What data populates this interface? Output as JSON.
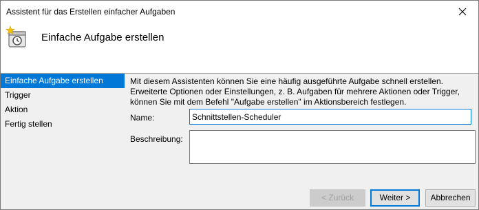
{
  "window": {
    "title": "Assistent für das Erstellen einfacher Aufgaben"
  },
  "header": {
    "title": "Einfache Aufgabe erstellen",
    "icon": "task-scheduler-icon"
  },
  "sidebar": {
    "items": [
      {
        "label": "Einfache Aufgabe erstellen",
        "active": true
      },
      {
        "label": "Trigger"
      },
      {
        "label": "Aktion"
      },
      {
        "label": "Fertig stellen"
      }
    ]
  },
  "main": {
    "intro": [
      "Mit diesem Assistenten können Sie eine häufig ausgeführte Aufgabe schnell erstellen.",
      "Erweiterte Optionen oder Einstellungen, z. B. Aufgaben für mehrere Aktionen oder Trigger,",
      "können Sie mit dem Befehl \"Aufgabe erstellen\" im Aktionsbereich festlegen."
    ],
    "name_label": "Name:",
    "name_value": "Schnittstellen-Scheduler",
    "description_label": "Beschreibung:",
    "description_value": ""
  },
  "buttons": {
    "back": "< Zurück",
    "next": "Weiter >",
    "cancel": "Abbrechen"
  },
  "colors": {
    "accent": "#0078d7",
    "window_bg": "#f0f0f0"
  }
}
